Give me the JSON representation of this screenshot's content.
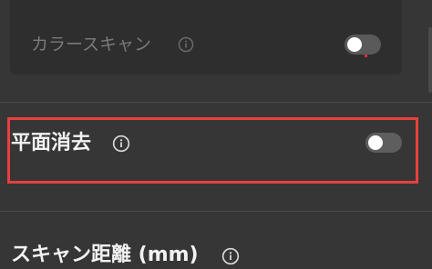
{
  "color_scan": {
    "label": "カラースキャン",
    "toggle_on": false
  },
  "plane_removal": {
    "label": "平面消去",
    "toggle_on": false
  },
  "scan_distance": {
    "label": "スキャン距離 (mm)"
  },
  "icons": {
    "info": "info-icon"
  },
  "colors": {
    "highlight": "#e8403f",
    "background": "#363636",
    "card": "#2e2e2e"
  }
}
